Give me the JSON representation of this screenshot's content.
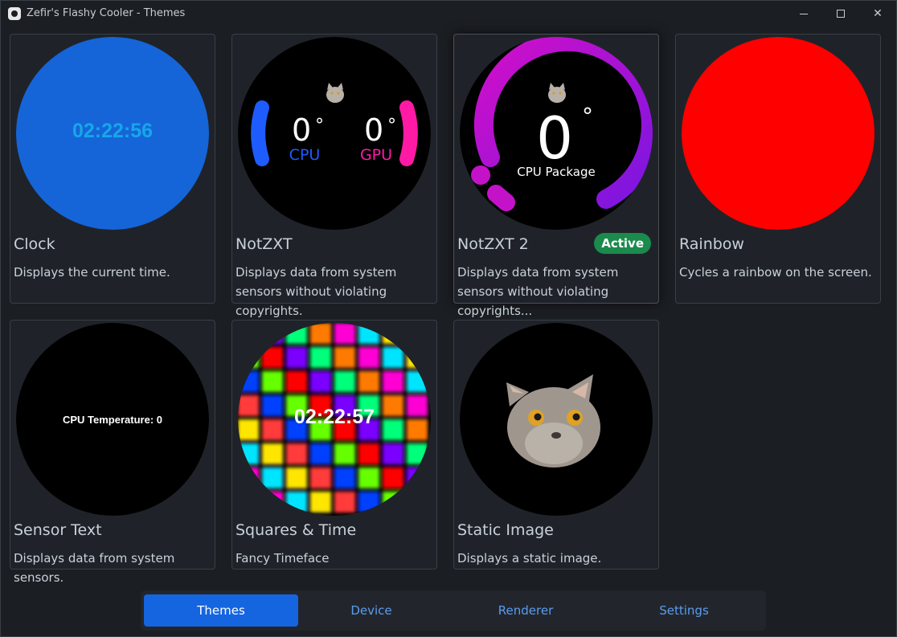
{
  "window": {
    "title": "Zefir's Flashy Cooler - Themes"
  },
  "themes": [
    {
      "name": "Clock",
      "description": "Displays the current time.",
      "preview": {
        "time": "02:22:56",
        "bg": "#1565d8",
        "text_color": "#17a6e8"
      }
    },
    {
      "name": "NotZXT",
      "description": "Displays data from system sensors without violating copyrights.",
      "preview": {
        "cpu_value": "0",
        "cpu_label": "CPU",
        "gpu_value": "0",
        "gpu_label": "GPU",
        "degree": "°",
        "icon": "cat-icon"
      }
    },
    {
      "name": "NotZXT 2",
      "description": "Displays data from system sensors without violating copyrights...",
      "badge": "Active",
      "preview": {
        "value": "0",
        "degree": "°",
        "label": "CPU Package",
        "icon": "cat-icon"
      }
    },
    {
      "name": "Rainbow",
      "description": "Cycles a rainbow on the screen.",
      "preview": {
        "bg": "#ff0000"
      }
    },
    {
      "name": "Sensor Text",
      "description": "Displays data from system sensors.",
      "preview": {
        "text": "CPU Temperature: 0"
      }
    },
    {
      "name": "Squares & Time",
      "description": "Fancy Timeface",
      "preview": {
        "time": "02:22:57"
      }
    },
    {
      "name": "Static Image",
      "description": "Displays a static image.",
      "preview": {
        "icon": "cat-photo"
      }
    }
  ],
  "nav": {
    "tabs": [
      {
        "label": "Themes",
        "selected": true
      },
      {
        "label": "Device",
        "selected": false
      },
      {
        "label": "Renderer",
        "selected": false
      },
      {
        "label": "Settings",
        "selected": false
      }
    ]
  },
  "colors": {
    "accent": "#1565e0",
    "active_badge": "#1b8a4d",
    "link": "#5b9cf0"
  }
}
